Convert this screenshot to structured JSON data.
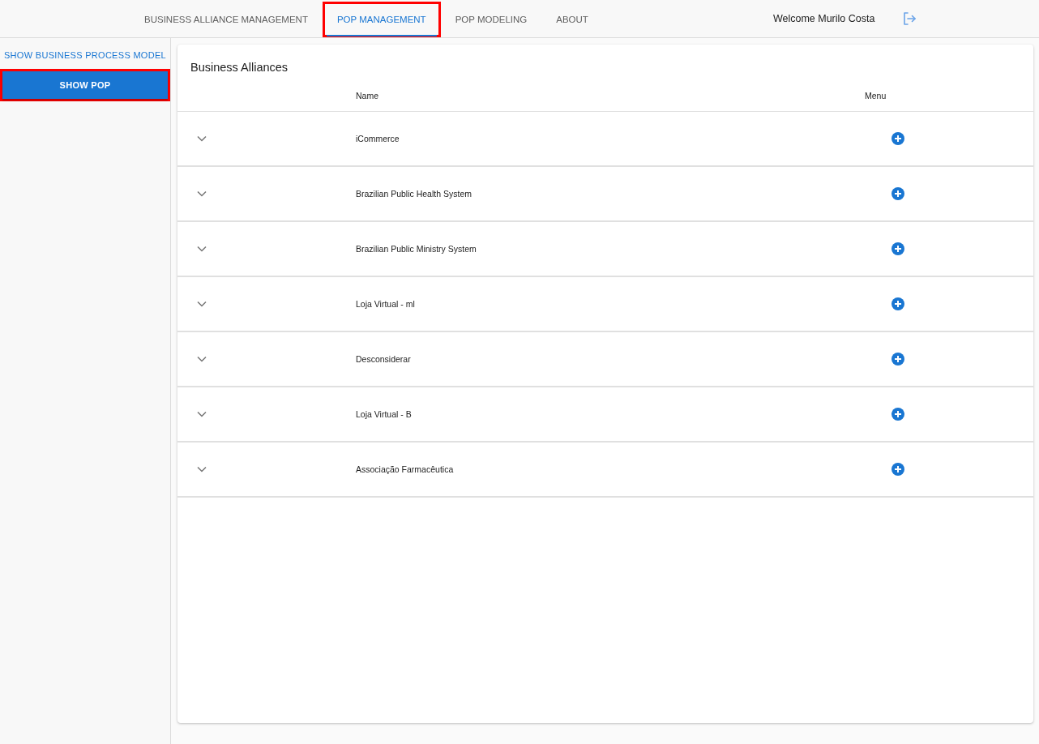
{
  "nav": {
    "tabs": [
      {
        "label": "BUSINESS ALLIANCE MANAGEMENT",
        "selected": false,
        "highlighted": false
      },
      {
        "label": "POP MANAGEMENT",
        "selected": true,
        "highlighted": true
      },
      {
        "label": "POP MODELING",
        "selected": false,
        "highlighted": false
      },
      {
        "label": "ABOUT",
        "selected": false,
        "highlighted": false
      }
    ],
    "welcome": "Welcome Murilo Costa"
  },
  "sidebar": {
    "items": [
      {
        "label": "SHOW BUSINESS PROCESS MODEL",
        "selected": false,
        "highlighted": false
      },
      {
        "label": "SHOW POP",
        "selected": true,
        "highlighted": true
      }
    ]
  },
  "card": {
    "title": "Business Alliances",
    "columns": [
      "Name",
      "Menu"
    ],
    "rows": [
      {
        "name": "iCommerce",
        "expanded": false
      },
      {
        "name": "Brazilian Public Health System",
        "expanded": false
      },
      {
        "name": "Brazilian Public Ministry System",
        "expanded": false
      },
      {
        "name": "Loja Virtual - ml",
        "expanded": false
      },
      {
        "name": "Desconsiderar",
        "expanded": false
      },
      {
        "name": "Loja Virtual - B",
        "expanded": false
      },
      {
        "name": "Associação Farmacêutica",
        "expanded": false
      }
    ]
  }
}
